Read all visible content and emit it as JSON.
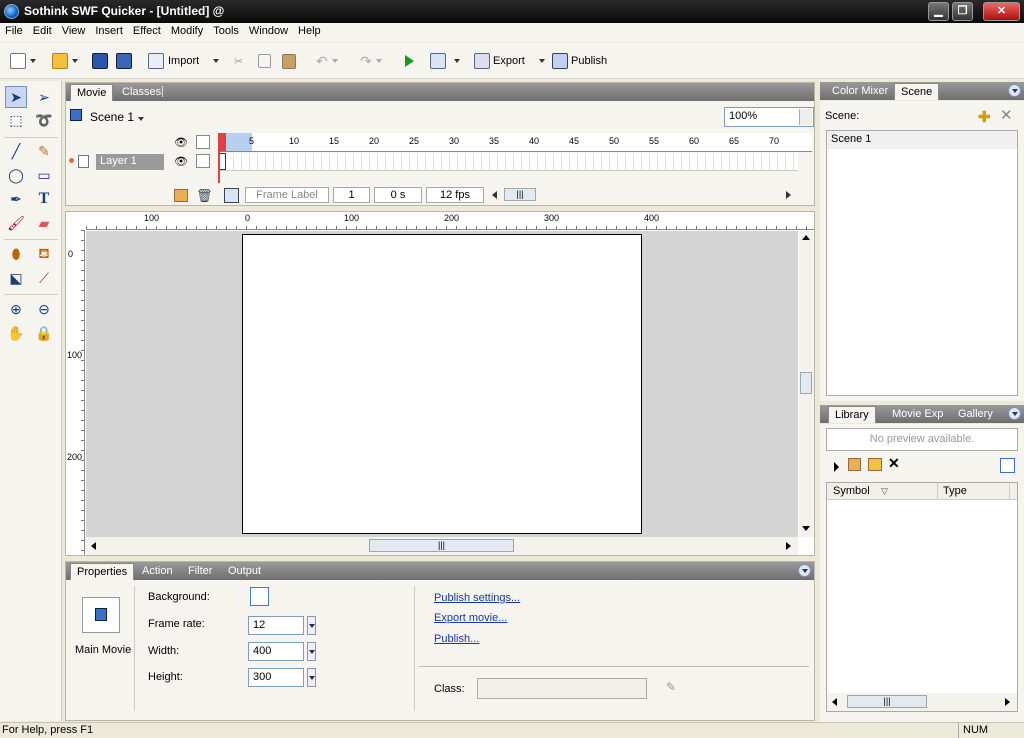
{
  "window": {
    "title": "Sothink SWF Quicker - [Untitled] @",
    "minimize": "▁",
    "restore": "❐",
    "close": "✕"
  },
  "menu": [
    "File",
    "Edit",
    "View",
    "Insert",
    "Effect",
    "Modify",
    "Tools",
    "Window",
    "Help"
  ],
  "toolbar": {
    "import_label": "Import",
    "export_label": "Export",
    "publish_label": "Publish"
  },
  "timeline": {
    "tabs": [
      "Movie",
      "Classes"
    ],
    "scene_label": "Scene 1",
    "zoom": "100%",
    "frame_ticks": [
      "5",
      "10",
      "15",
      "20",
      "25",
      "30",
      "35",
      "40",
      "45",
      "50",
      "55",
      "60",
      "65",
      "70"
    ],
    "layer_name": "Layer 1",
    "frame_label_placeholder": "Frame Label",
    "current_frame": "1",
    "time": "0 s",
    "fps": "12 fps"
  },
  "stage": {
    "hruler_labels": [
      "100",
      "0",
      "100",
      "200",
      "300",
      "400"
    ],
    "vruler_labels": [
      "0",
      "100",
      "200"
    ]
  },
  "properties": {
    "tabs": [
      "Properties",
      "Action",
      "Filter",
      "Output"
    ],
    "main_movie_label": "Main Movie",
    "background_label": "Background:",
    "frame_rate_label": "Frame rate:",
    "frame_rate_value": "12",
    "width_label": "Width:",
    "width_value": "400",
    "height_label": "Height:",
    "height_value": "300",
    "publish_settings_link": "Publish settings...",
    "export_movie_link": "Export movie...",
    "publish_link": "Publish...",
    "class_label": "Class:"
  },
  "scene_panel": {
    "tabs": [
      "Color Mixer",
      "Scene"
    ],
    "scene_label": "Scene:",
    "scenes": [
      "Scene 1"
    ]
  },
  "library_panel": {
    "tabs": [
      "Library",
      "Movie Exp",
      "Gallery"
    ],
    "preview_text": "No preview available.",
    "col_symbol": "Symbol",
    "col_type": "Type"
  },
  "status": {
    "help": "For Help, press F1",
    "num": "NUM"
  },
  "colors": {
    "accent": "#316ac5",
    "panel_header": "#7a7a7a",
    "playhead": "#e04040"
  }
}
